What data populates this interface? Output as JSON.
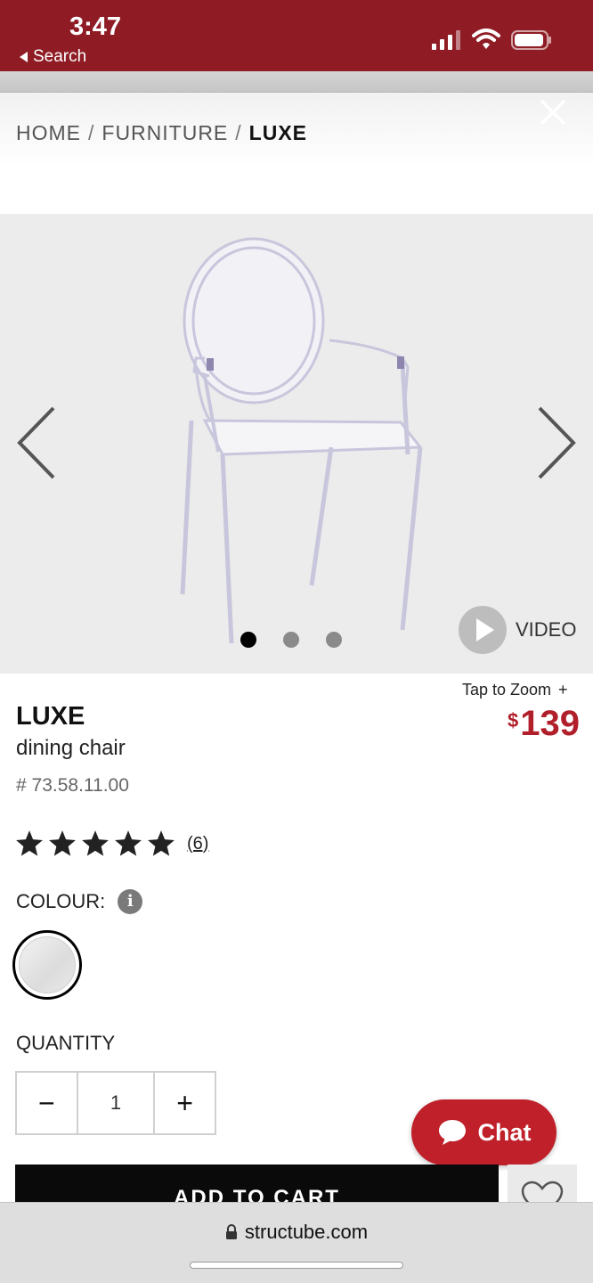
{
  "status_bar": {
    "time": "3:47",
    "back_label": "Search",
    "icons": [
      "signal-icon",
      "wifi-icon",
      "battery-icon"
    ]
  },
  "breadcrumb": {
    "items": [
      "HOME",
      "FURNITURE",
      "LUXE"
    ],
    "separator": "/"
  },
  "gallery": {
    "image": "clear-ghost-armchair",
    "slides_total": 3,
    "active_slide": 1,
    "video_label": "VIDEO",
    "icons": [
      "chevron-left-icon",
      "chevron-right-icon",
      "play-icon",
      "close-icon"
    ]
  },
  "product": {
    "tap_to_zoom": "Tap to Zoom",
    "zoom_symbol": "+",
    "currency_symbol": "$",
    "price": "139",
    "name": "LUXE",
    "subtitle": "dining chair",
    "sku": "# 73.58.11.00",
    "rating": 5,
    "review_count": "(6)"
  },
  "options": {
    "colour_label": "COLOUR:",
    "info_symbol": "i",
    "selected_colour": "clear",
    "quantity_label": "QUANTITY",
    "quantity_value": "1",
    "minus_symbol": "−",
    "plus_symbol": "+"
  },
  "actions": {
    "chat_label": "Chat",
    "add_to_cart_label": "ADD TO CART"
  },
  "browser": {
    "url": "structube.com"
  },
  "colors": {
    "brand_red": "#8f1c25",
    "price_red": "#b01f2a",
    "chat_red": "#c0202a"
  }
}
